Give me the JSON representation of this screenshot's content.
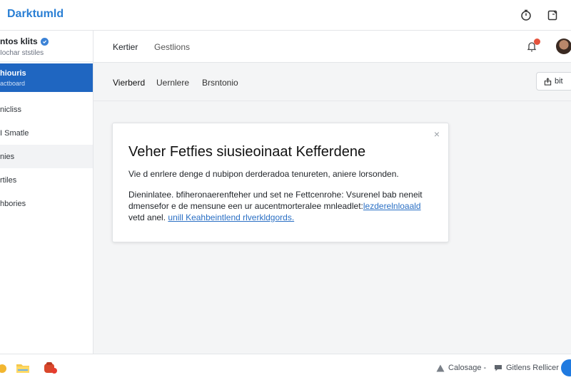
{
  "app": {
    "title": "Darktumld"
  },
  "topbar": {
    "icons": [
      "timer-icon",
      "clipboard-icon"
    ]
  },
  "sidebar": {
    "profile": {
      "name": "ntos klits",
      "handle": "Iochar ststiles"
    },
    "active_item": {
      "label": "hiouris",
      "sub": "actboard"
    },
    "items": [
      {
        "label": "nicliss"
      },
      {
        "label": "I Smatle"
      },
      {
        "label": "nies"
      },
      {
        "label": "rtiles"
      },
      {
        "label": "hbories"
      }
    ]
  },
  "header": {
    "tabs": [
      {
        "label": "Kertier"
      },
      {
        "label": "Gestlions"
      }
    ]
  },
  "content": {
    "tabs": [
      {
        "label": "Vierberd"
      },
      {
        "label": "Uernlere"
      },
      {
        "label": "Brsntonio"
      }
    ],
    "share_label": "bit"
  },
  "dialog": {
    "title": "Veher Fetfies siusieoinaat Kefferdene",
    "text": "Vie d enrlere denge d nubipon derderadoa tenureten, aniere lorsonden.",
    "para_line1": "Dieninlatee. bfiheronaerenfteher und set ne Fettcenrohe: Vsurenel bab neneit",
    "para_line2_prefix": "dmensefor e de mensune een ur aucentmorteralee mnleadlet:",
    "para_line2_link": "lezderelnloaald",
    "para_line3_prefix": "vetd anel.",
    "para_line3_link": "unill Keahbeintlend rlverkldgords."
  },
  "bottombar": {
    "status_left": "Calosage -",
    "status_right": "Gitlens Rellicer"
  }
}
